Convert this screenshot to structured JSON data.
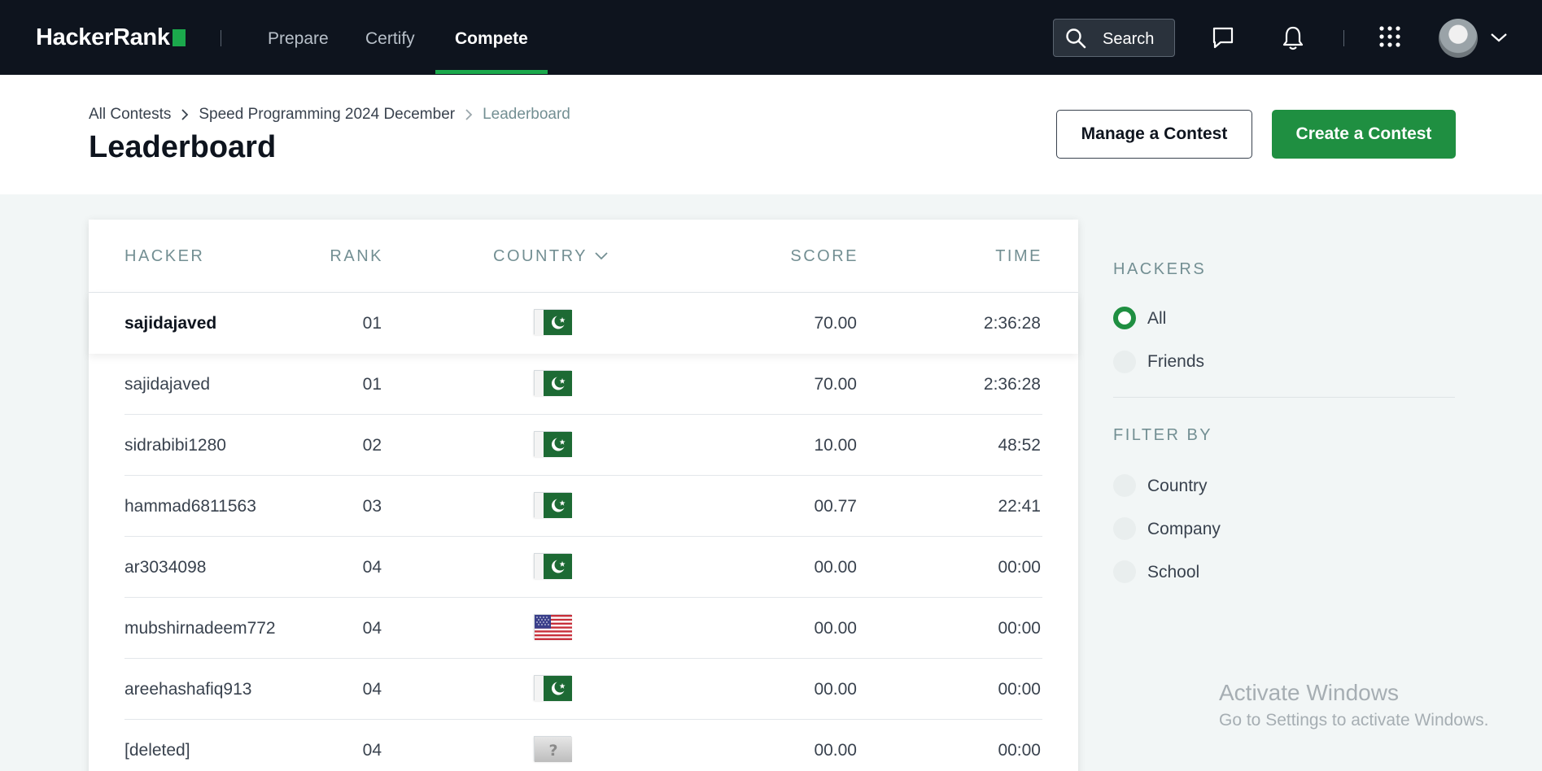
{
  "app": {
    "logo": "HackerRank",
    "nav": [
      {
        "label": "Prepare"
      },
      {
        "label": "Certify"
      },
      {
        "label": "Compete"
      }
    ],
    "search_label": "Search",
    "accent_color": "#1ba94c",
    "icons": [
      "search-icon",
      "chat-icon",
      "bell-icon",
      "apps-grid-icon",
      "chevron-down-icon"
    ]
  },
  "breadcrumb": [
    "All Contests",
    "Speed Programming 2024 December",
    "Leaderboard"
  ],
  "page_title": "Leaderboard",
  "buttons": {
    "manage": "Manage a Contest",
    "create": "Create a Contest"
  },
  "table": {
    "columns": [
      "HACKER",
      "RANK",
      "COUNTRY",
      "SCORE",
      "TIME"
    ],
    "rows": [
      {
        "hacker": "sajidajaved",
        "rank": "01",
        "country": "pakistan-flag",
        "score": "70.00",
        "time": "2:36:28"
      },
      {
        "hacker": "sajidajaved",
        "rank": "01",
        "country": "pakistan-flag",
        "score": "70.00",
        "time": "2:36:28"
      },
      {
        "hacker": "sidrabibi1280",
        "rank": "02",
        "country": "pakistan-flag",
        "score": "10.00",
        "time": "48:52"
      },
      {
        "hacker": "hammad6811563",
        "rank": "03",
        "country": "pakistan-flag",
        "score": "00.77",
        "time": "22:41"
      },
      {
        "hacker": "ar3034098",
        "rank": "04",
        "country": "pakistan-flag",
        "score": "00.00",
        "time": "00:00"
      },
      {
        "hacker": "mubshirnadeem772",
        "rank": "04",
        "country": "usa-flag",
        "score": "00.00",
        "time": "00:00"
      },
      {
        "hacker": "areehashafiq913",
        "rank": "04",
        "country": "pakistan-flag",
        "score": "00.00",
        "time": "00:00"
      },
      {
        "hacker": "[deleted]",
        "rank": "04",
        "country": "unknown-flag",
        "score": "00.00",
        "time": "00:00"
      }
    ]
  },
  "sidebar": {
    "hackers_heading": "HACKERS",
    "hackers_options": [
      {
        "label": "All",
        "checked": true
      },
      {
        "label": "Friends",
        "checked": false
      }
    ],
    "filter_heading": "FILTER BY",
    "filter_options": [
      {
        "label": "Country"
      },
      {
        "label": "Company"
      },
      {
        "label": "School"
      }
    ]
  },
  "watermark": {
    "title": "Activate Windows",
    "subtitle": "Go to Settings to activate Windows."
  }
}
